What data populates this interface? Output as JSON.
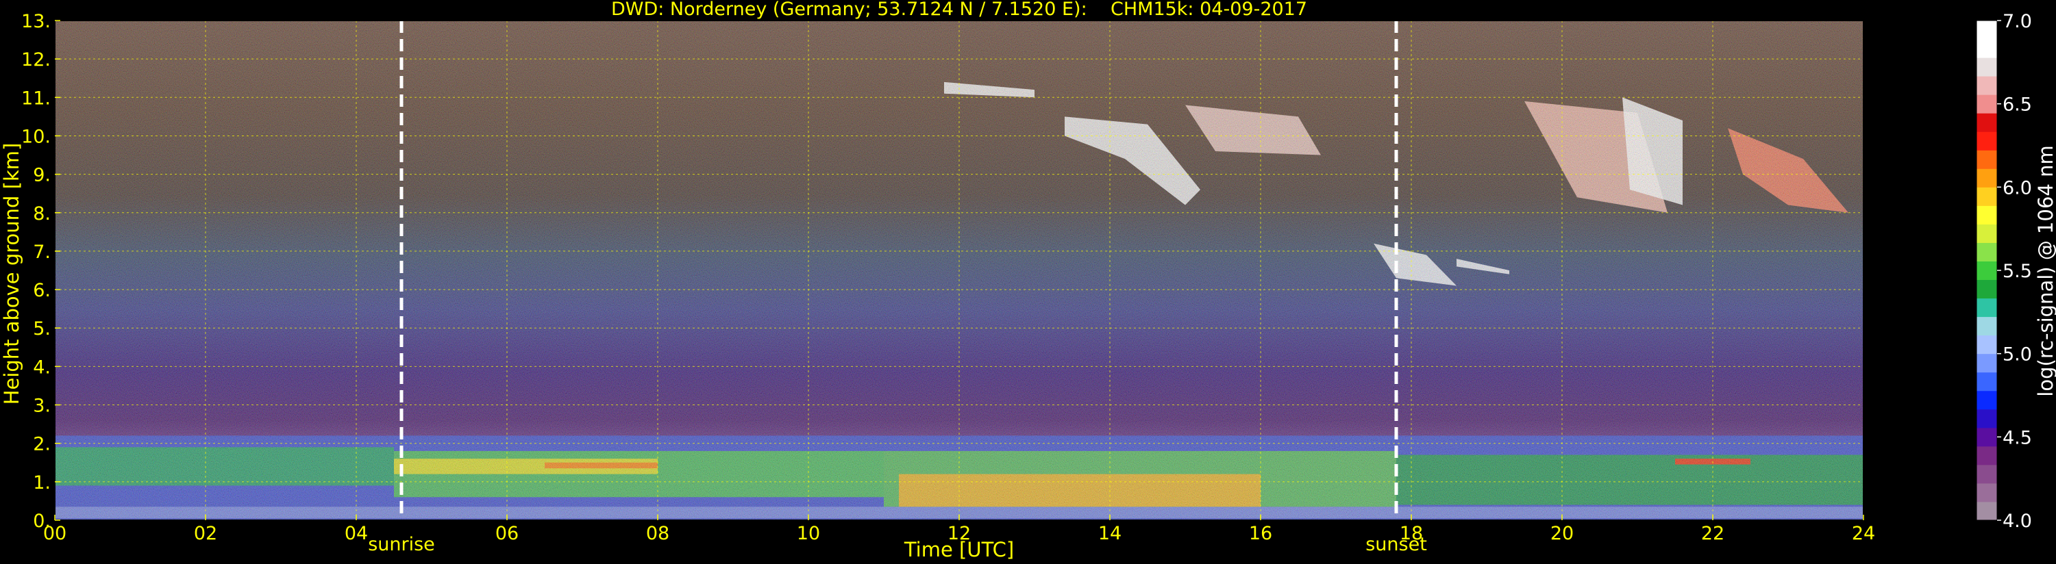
{
  "chart_data": {
    "type": "heatmap",
    "title": "DWD: Norderney (Germany; 53.7124 N / 7.1520 E):    CHM15k: 04-09-2017",
    "xlabel": "Time [UTC]",
    "ylabel": "Height above ground [km]",
    "xlim": [
      0,
      24
    ],
    "ylim": [
      0,
      13
    ],
    "x_ticks": [
      "00",
      "02",
      "04",
      "06",
      "08",
      "10",
      "12",
      "14",
      "16",
      "18",
      "20",
      "22",
      "24"
    ],
    "y_ticks": [
      "0.",
      "1.",
      "2.",
      "3.",
      "4.",
      "5.",
      "6.",
      "7.",
      "8.",
      "9.",
      "10.",
      "11.",
      "12.",
      "13."
    ],
    "grid": true,
    "colorbar": {
      "label": "log(rc-signal) @ 1064 nm",
      "range": [
        4.0,
        7.0
      ],
      "ticks": [
        "4.0",
        "4.5",
        "5.0",
        "5.5",
        "6.0",
        "6.5",
        "7.0"
      ],
      "colors": [
        "#a38ea3",
        "#9a6e9a",
        "#8a4c8e",
        "#7a2a86",
        "#5a0ea0",
        "#2a10c8",
        "#0a2aff",
        "#3a66ff",
        "#7a9aff",
        "#a8c2ff",
        "#9ed8e4",
        "#2ec4a4",
        "#1ea83a",
        "#3ccc3c",
        "#8ae24a",
        "#d8f03a",
        "#ffff30",
        "#ffd020",
        "#ffa010",
        "#ff6a10",
        "#ff2010",
        "#e01010",
        "#f08e8e",
        "#f0b8b8",
        "#e8e0e0",
        "#ffffff",
        "#ffffff"
      ]
    },
    "events": [
      {
        "label": "sunrise",
        "x": 4.6
      },
      {
        "label": "sunset",
        "x": 17.8
      }
    ]
  }
}
